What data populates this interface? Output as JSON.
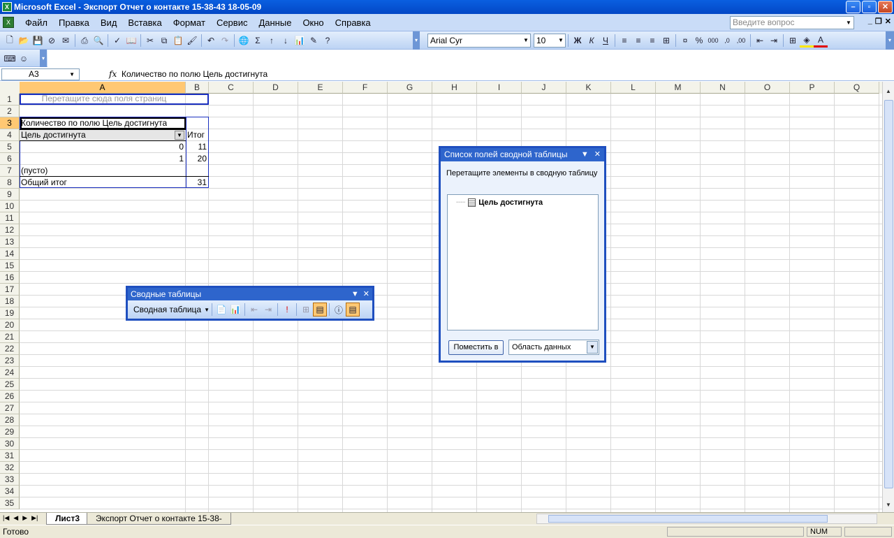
{
  "window": {
    "title": "Microsoft Excel - Экспорт Отчет о контакте 15-38-43 18-05-09",
    "app_icon": "excel-icon"
  },
  "menu": {
    "items": [
      "Файл",
      "Правка",
      "Вид",
      "Вставка",
      "Формат",
      "Сервис",
      "Данные",
      "Окно",
      "Справка"
    ],
    "ask_placeholder": "Введите вопрос"
  },
  "toolbar": {
    "font": "Arial Cyr",
    "size": "10"
  },
  "formula_bar": {
    "cell_ref": "A3",
    "fx": "fx",
    "formula": "Количество по полю Цель достигнута"
  },
  "columns": [
    "A",
    "B",
    "C",
    "D",
    "E",
    "F",
    "G",
    "H",
    "I",
    "J",
    "K",
    "L",
    "M",
    "N",
    "O",
    "P",
    "Q"
  ],
  "rows": [
    "1",
    "2",
    "3",
    "4",
    "5",
    "6",
    "7",
    "8",
    "9",
    "10",
    "11",
    "12",
    "13",
    "14",
    "15",
    "16",
    "17",
    "18",
    "19",
    "20",
    "21",
    "22",
    "23",
    "24",
    "25",
    "26",
    "27",
    "28",
    "29",
    "30",
    "31",
    "32",
    "33",
    "34",
    "35"
  ],
  "pivot": {
    "page_drop": "Перетащите сюда поля страниц",
    "data_field": "Количество по полю Цель достигнута",
    "row_field": "Цель достигнута",
    "total_header": "Итог",
    "rows": [
      {
        "label": "0",
        "value": "11"
      },
      {
        "label": "1",
        "value": "20"
      },
      {
        "label": "(пусто)",
        "value": ""
      }
    ],
    "grand_total_label": "Общий итог",
    "grand_total_value": "31"
  },
  "pivot_toolbar": {
    "title": "Сводные таблицы",
    "menu_label": "Сводная таблица"
  },
  "field_list": {
    "title": "Список полей сводной таблицы",
    "instruction": "Перетащите элементы в сводную таблицу",
    "fields": [
      "Цель достигнута"
    ],
    "button": "Поместить в",
    "area": "Область данных"
  },
  "sheets": {
    "active": "Лист3",
    "other": "Экспорт Отчет о контакте 15-38-"
  },
  "status": {
    "ready": "Готово",
    "num": "NUM"
  }
}
